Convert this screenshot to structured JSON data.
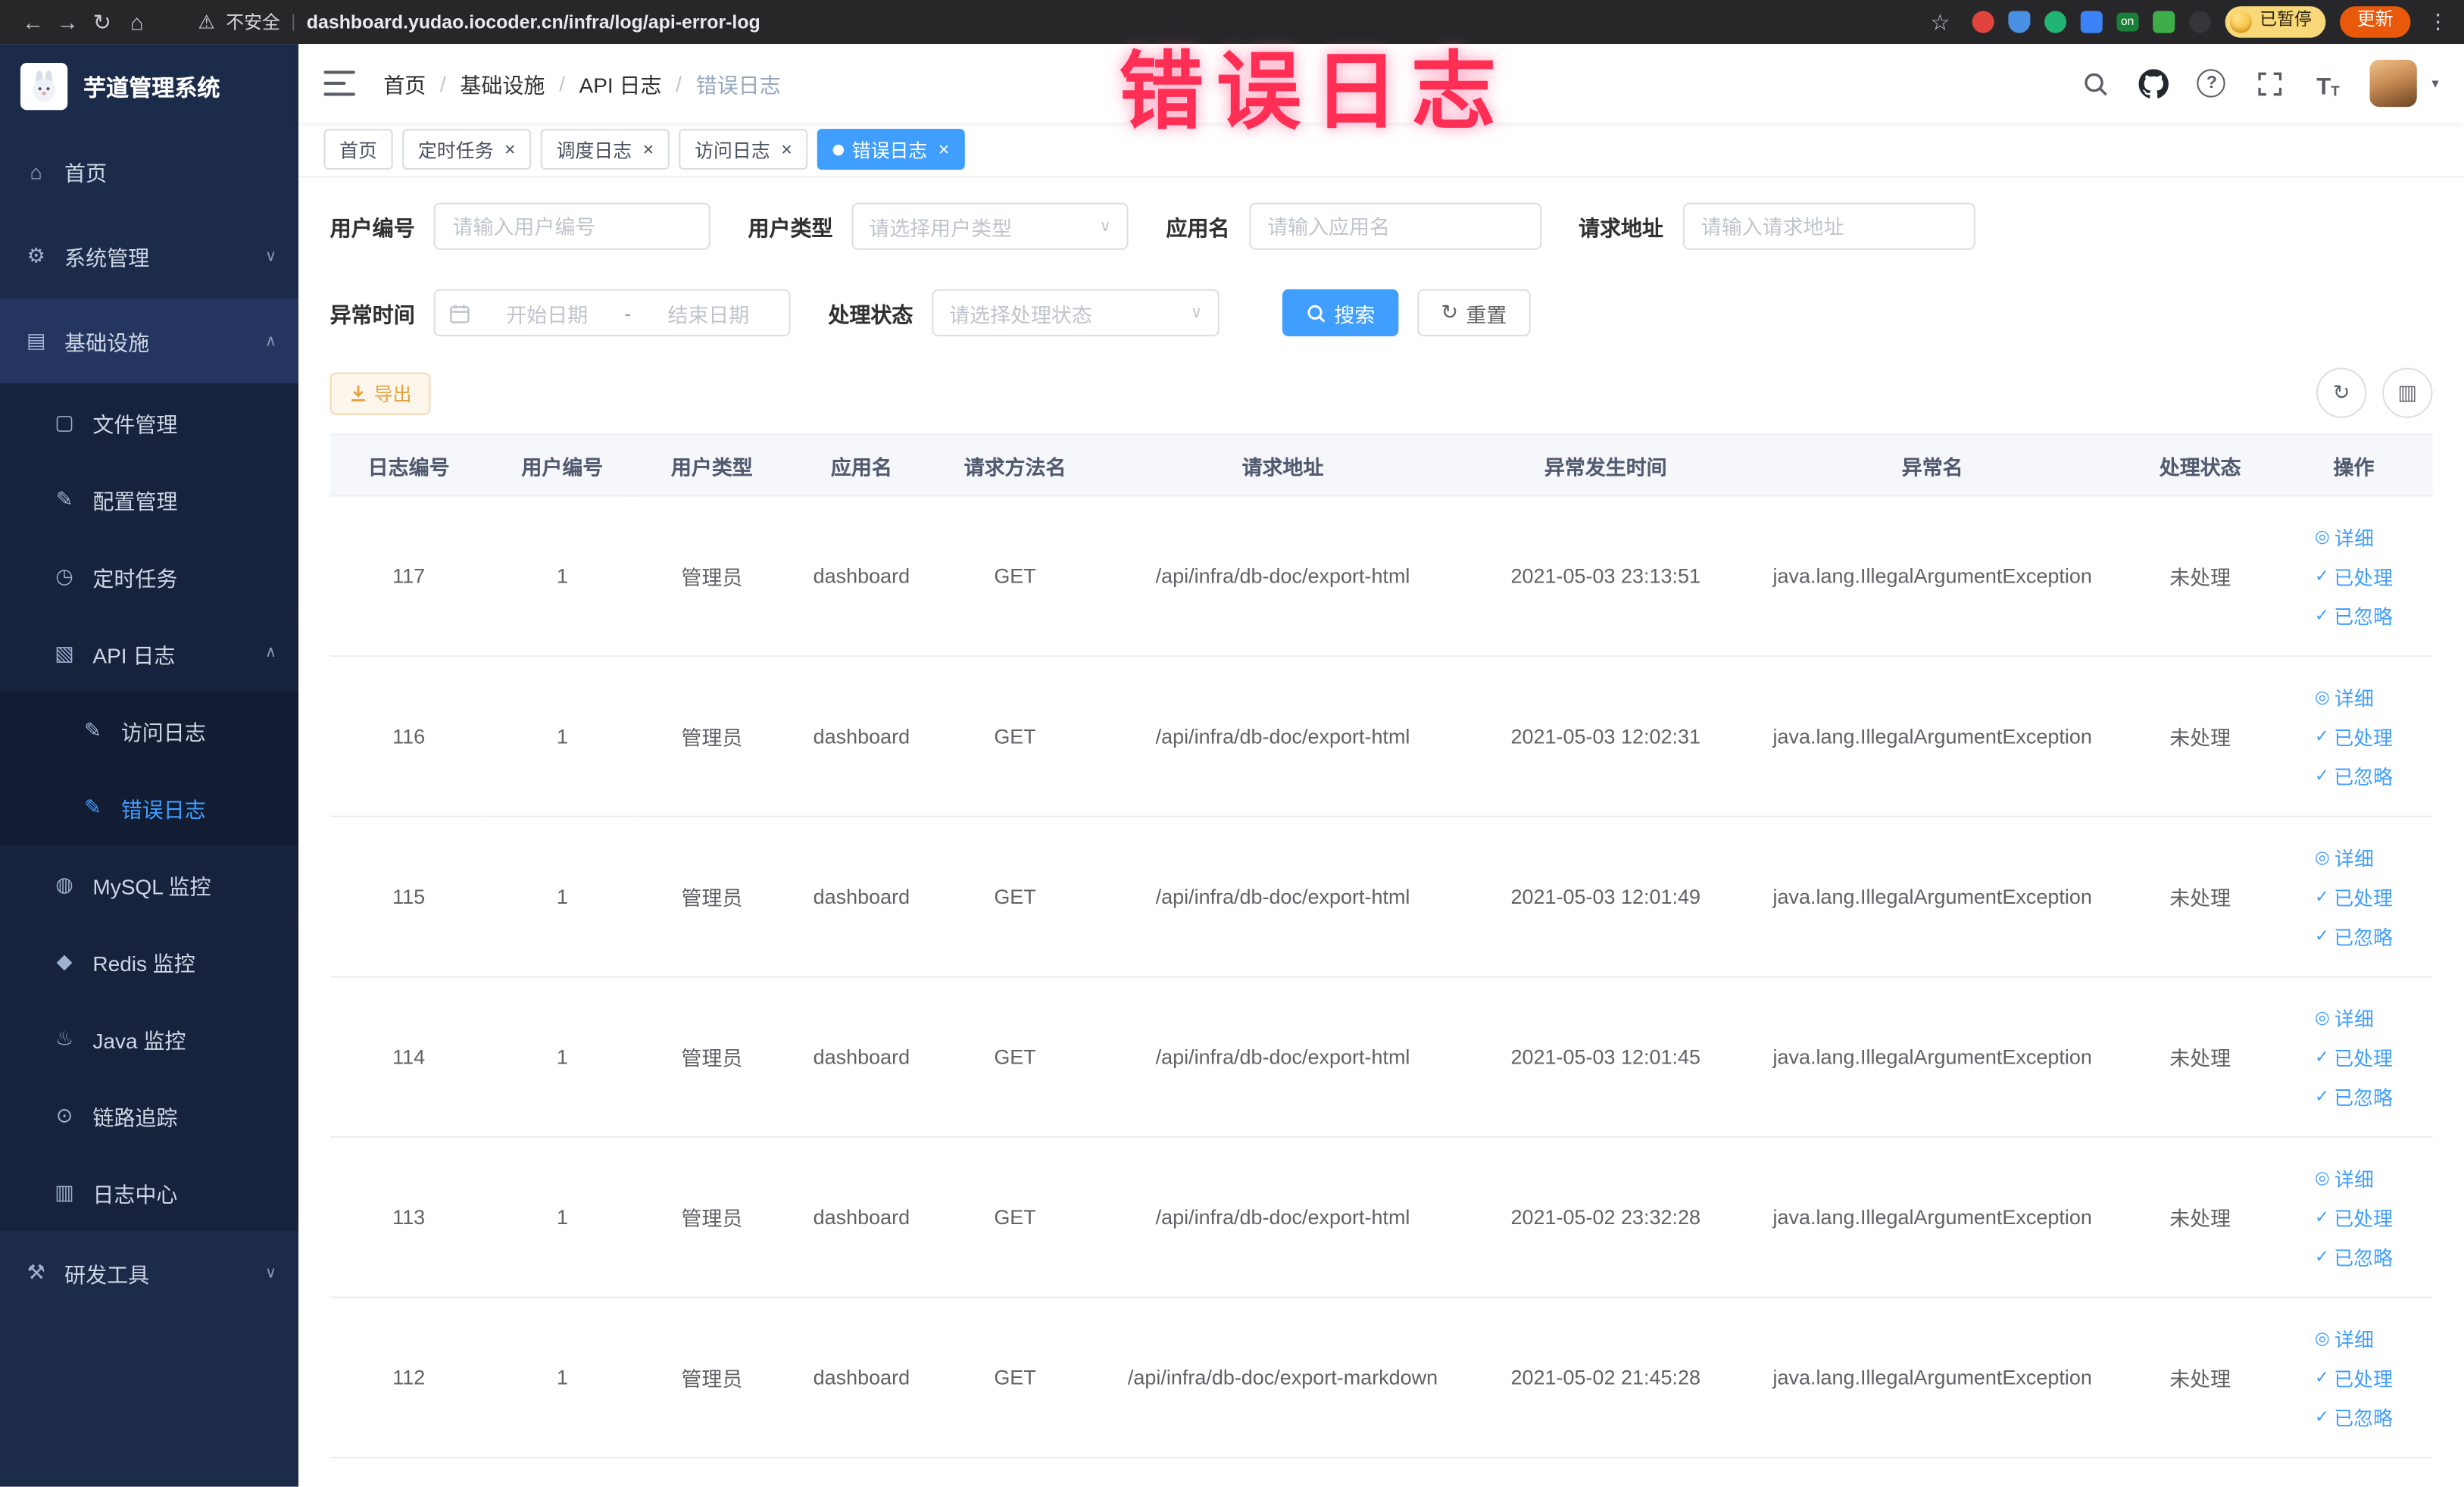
{
  "colors": {
    "accent": "#409eff",
    "sidebar_bg": "#1d2b4b",
    "annotation": "#ff2e55",
    "warning": "#e6a23c"
  },
  "browser": {
    "security_label": "不安全",
    "url": "dashboard.yudao.iocoder.cn/infra/log/api-error-log",
    "on_badge": "on",
    "paused_badge": "已暂停",
    "update_label": "更新"
  },
  "annotation": {
    "text": "错误日志"
  },
  "sidebar": {
    "logo_title": "芋道管理系统",
    "items": [
      {
        "key": "home",
        "label": "首页",
        "icon": "home-icon",
        "level": 0
      },
      {
        "key": "system",
        "label": "系统管理",
        "icon": "gear-icon",
        "level": 0,
        "chevron": "down"
      },
      {
        "key": "infra",
        "label": "基础设施",
        "icon": "infra-icon",
        "level": 0,
        "chevron": "up",
        "open": true
      },
      {
        "key": "file",
        "label": "文件管理",
        "icon": "folder-icon",
        "level": 1
      },
      {
        "key": "config",
        "label": "配置管理",
        "icon": "config-icon",
        "level": 1
      },
      {
        "key": "job",
        "label": "定时任务",
        "icon": "timer-icon",
        "level": 1
      },
      {
        "key": "api-log",
        "label": "API 日志",
        "icon": "api-log-icon",
        "level": 1,
        "chevron": "up"
      },
      {
        "key": "access-log",
        "label": "访问日志",
        "icon": "access-log-icon",
        "level": 2
      },
      {
        "key": "error-log",
        "label": "错误日志",
        "icon": "error-log-icon",
        "level": 2,
        "active": true
      },
      {
        "key": "mysql",
        "label": "MySQL 监控",
        "icon": "mysql-icon",
        "level": 1
      },
      {
        "key": "redis",
        "label": "Redis 监控",
        "icon": "redis-icon",
        "level": 1
      },
      {
        "key": "java",
        "label": "Java 监控",
        "icon": "java-icon",
        "level": 1
      },
      {
        "key": "trace",
        "label": "链路追踪",
        "icon": "trace-icon",
        "level": 1
      },
      {
        "key": "log-center",
        "label": "日志中心",
        "icon": "log-center-icon",
        "level": 1
      },
      {
        "key": "dev-tools",
        "label": "研发工具",
        "icon": "tools-icon",
        "level": 0,
        "chevron": "down"
      }
    ]
  },
  "header": {
    "breadcrumb": [
      "首页",
      "基础设施",
      "API 日志",
      "错误日志"
    ]
  },
  "tabs": [
    {
      "key": "home",
      "label": "首页",
      "closable": false,
      "active": false
    },
    {
      "key": "job",
      "label": "定时任务",
      "closable": true,
      "active": false
    },
    {
      "key": "job-log",
      "label": "调度日志",
      "closable": true,
      "active": false
    },
    {
      "key": "access-log",
      "label": "访问日志",
      "closable": true,
      "active": false
    },
    {
      "key": "error-log",
      "label": "错误日志",
      "closable": true,
      "active": true
    }
  ],
  "filters": {
    "user_id": {
      "label": "用户编号",
      "placeholder": "请输入用户编号"
    },
    "user_type": {
      "label": "用户类型",
      "placeholder": "请选择用户类型"
    },
    "app_name": {
      "label": "应用名",
      "placeholder": "请输入应用名"
    },
    "request_url": {
      "label": "请求地址",
      "placeholder": "请输入请求地址"
    },
    "exception_time": {
      "label": "异常时间",
      "start_placeholder": "开始日期",
      "separator": "-",
      "end_placeholder": "结束日期"
    },
    "process_status": {
      "label": "处理状态",
      "placeholder": "请选择处理状态"
    },
    "search_label": "搜索",
    "reset_label": "重置"
  },
  "toolbar": {
    "export_label": "导出"
  },
  "table": {
    "columns": [
      "日志编号",
      "用户编号",
      "用户类型",
      "应用名",
      "请求方法名",
      "请求地址",
      "异常发生时间",
      "异常名",
      "处理状态",
      "操作"
    ],
    "rows": [
      [
        "117",
        "1",
        "管理员",
        "dashboard",
        "GET",
        "/api/infra/db-doc/export-html",
        "2021-05-03 23:13:51",
        "java.lang.IllegalArgumentException",
        "未处理"
      ],
      [
        "116",
        "1",
        "管理员",
        "dashboard",
        "GET",
        "/api/infra/db-doc/export-html",
        "2021-05-03 12:02:31",
        "java.lang.IllegalArgumentException",
        "未处理"
      ],
      [
        "115",
        "1",
        "管理员",
        "dashboard",
        "GET",
        "/api/infra/db-doc/export-html",
        "2021-05-03 12:01:49",
        "java.lang.IllegalArgumentException",
        "未处理"
      ],
      [
        "114",
        "1",
        "管理员",
        "dashboard",
        "GET",
        "/api/infra/db-doc/export-html",
        "2021-05-03 12:01:45",
        "java.lang.IllegalArgumentException",
        "未处理"
      ],
      [
        "113",
        "1",
        "管理员",
        "dashboard",
        "GET",
        "/api/infra/db-doc/export-html",
        "2021-05-02 23:32:28",
        "java.lang.IllegalArgumentException",
        "未处理"
      ],
      [
        "112",
        "1",
        "管理员",
        "dashboard",
        "GET",
        "/api/infra/db-doc/export-markdown",
        "2021-05-02 21:45:28",
        "java.lang.IllegalArgumentException",
        "未处理"
      ]
    ],
    "actions": [
      {
        "key": "detail",
        "label": "详细",
        "icon": "eye-icon"
      },
      {
        "key": "processed",
        "label": "已处理",
        "icon": "check-icon"
      },
      {
        "key": "ignored",
        "label": "已忽略",
        "icon": "check-icon"
      }
    ]
  }
}
